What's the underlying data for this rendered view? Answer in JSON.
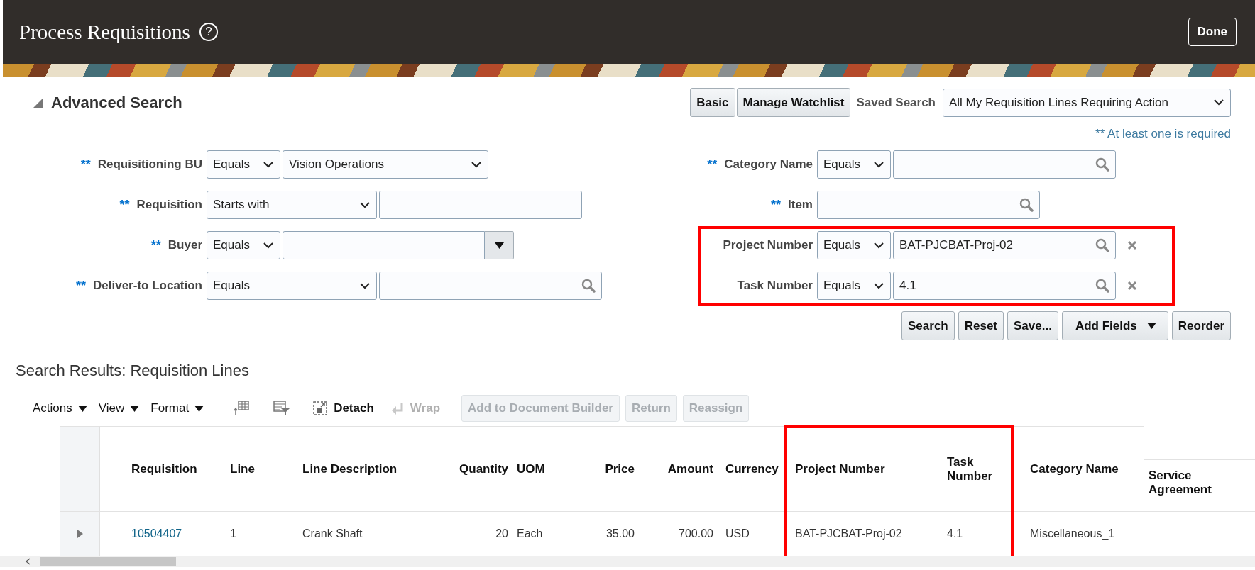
{
  "header": {
    "title": "Process Requisitions",
    "help_glyph": "?",
    "done_button": "Done"
  },
  "search": {
    "title": "Advanced Search",
    "expanded": true,
    "buttons": [
      {
        "label": "Basic"
      },
      {
        "label": "Manage Watchlist"
      }
    ],
    "saved_search": {
      "label": "Saved Search",
      "value": "All My Requisition Lines Requiring Action"
    },
    "required_note": "** At least one is required",
    "left_fields": [
      {
        "required_mark": "**",
        "label": "Requisitioning BU",
        "operator": "Equals",
        "kind": "select",
        "value": "Vision Operations",
        "removable": false
      },
      {
        "required_mark": "**",
        "label": "Requisition",
        "operator": "Starts with",
        "kind": "text",
        "removable": false
      },
      {
        "required_mark": "**",
        "label": "Buyer",
        "operator": "Equals",
        "kind": "combo",
        "removable": false
      },
      {
        "required_mark": "**",
        "label": "Deliver-to Location",
        "operator": "Equals",
        "kind": "search",
        "removable": false
      }
    ],
    "right_fields": [
      {
        "required_mark": "**",
        "label": "Category Name",
        "operator": "Equals",
        "kind": "search",
        "removable": false
      },
      {
        "required_mark": "**",
        "label": "Item",
        "kind": "search",
        "removable": false
      },
      {
        "label": "Project Number",
        "operator": "Equals",
        "kind": "search",
        "value": "BAT-PJCBAT-Proj-02",
        "removable": true
      },
      {
        "label": "Task Number",
        "operator": "Equals",
        "kind": "search",
        "value": "4.1",
        "removable": true
      }
    ],
    "actions": [
      {
        "label": "Search",
        "kind": "button"
      },
      {
        "label": "Reset",
        "kind": "button"
      },
      {
        "label": "Save...",
        "kind": "button"
      },
      {
        "label": "Add Fields",
        "kind": "menu"
      },
      {
        "label": "Reorder",
        "kind": "button"
      }
    ]
  },
  "results": {
    "title": "Search Results: Requisition Lines",
    "menus": [
      {
        "label": "Actions"
      },
      {
        "label": "View"
      },
      {
        "label": "Format"
      }
    ],
    "detach": {
      "label": "Detach",
      "disabled": false
    },
    "wrap": {
      "label": "Wrap",
      "disabled": true
    },
    "buttons": [
      {
        "label": "Add to Document Builder",
        "disabled": true
      },
      {
        "label": "Return",
        "disabled": true
      },
      {
        "label": "Reassign",
        "disabled": true
      }
    ],
    "columns": [
      "Requisition",
      "Line",
      "Line Description",
      "Quantity",
      "UOM",
      "Price",
      "Amount",
      "Currency",
      "Project Number",
      "Task Number",
      "Category Name",
      "Service Agreement"
    ],
    "rows": [
      {
        "expanded": false,
        "cells": [
          {
            "text": "10504407",
            "kind": "link"
          },
          {
            "text": "1",
            "kind": "text"
          },
          {
            "text": "Crank Shaft",
            "kind": "text"
          },
          {
            "text": "20",
            "kind": "text"
          },
          {
            "text": "Each",
            "kind": "text"
          },
          {
            "text": "35.00",
            "kind": "text"
          },
          {
            "text": "700.00",
            "kind": "text"
          },
          {
            "text": "USD",
            "kind": "text"
          },
          {
            "text": "BAT-PJCBAT-Proj-02",
            "kind": "text"
          },
          {
            "text": "4.1",
            "kind": "text"
          },
          {
            "text": "Miscellaneous_1",
            "kind": "text"
          }
        ]
      }
    ]
  }
}
